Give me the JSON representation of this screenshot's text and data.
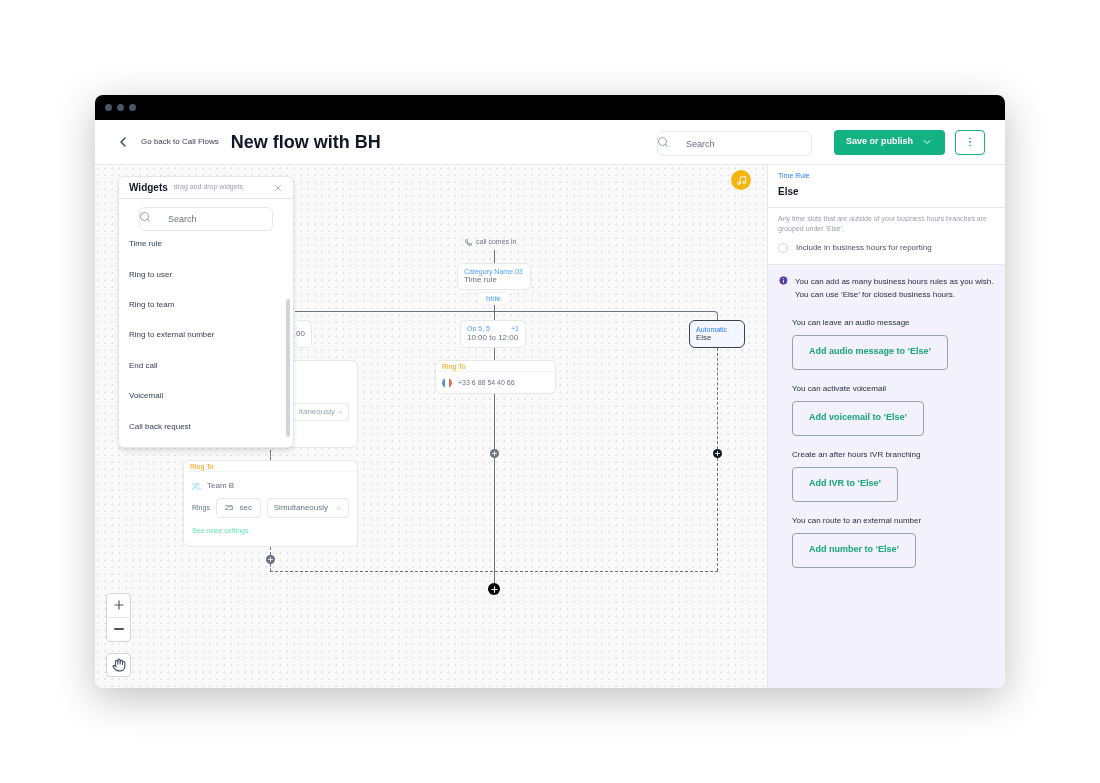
{
  "header": {
    "back_link": "Go back to Call Flows",
    "title": "New flow with BH",
    "search": {
      "placeholder": "Search"
    },
    "primary_button": "Save or publish"
  },
  "widgets_panel": {
    "title": "Widgets",
    "subtitle": "drag and drop widgets",
    "search": {
      "placeholder": "Search"
    },
    "items": [
      "Time rule",
      "Ring to user",
      "Ring to team",
      "Ring to external number",
      "End call",
      "Voicemail",
      "Call back request"
    ]
  },
  "flow": {
    "trigger": "call comes in",
    "rule_node": {
      "category": "Category Name 03",
      "title": "Time rule"
    },
    "toggle": "hide",
    "branch_nodes": [
      {
        "kind": "partial",
        "text": "00",
        "selected": false
      },
      {
        "kind": "slot",
        "label": "On 5, 5",
        "badge": "+1",
        "text": "10:00 to 12:00",
        "selected": false
      },
      {
        "kind": "automatic",
        "label": "Automatic",
        "text": "Else",
        "selected": true
      }
    ],
    "partial_card": {
      "dropdown": "ltaneously"
    },
    "ring_number": {
      "label": "Ring To",
      "number": "+33 6 88 54 40 66"
    },
    "ring_team": {
      "label": "Ring To",
      "team": "Team B",
      "rings_label": "Rings",
      "rings_value": "25",
      "unit": "sec",
      "mode": "Simultaneously",
      "link": "See more settings"
    }
  },
  "inspector": {
    "label": "Time Rule",
    "title": "Else",
    "description": "Any time slots that are outside of your business hours branches are grouped under ‘Else’.",
    "checkbox": {
      "label": "Include in business hours for reporting",
      "checked": false
    },
    "info": "You can add as many business hours rules as you wish. You can use ‘Else’ for closed business hours.",
    "actions": [
      {
        "caption": "You can leave an audio message",
        "button": "Add audio message to ‘Else’"
      },
      {
        "caption": "You can activate voicemail",
        "button": "Add voicemail to ‘Else’"
      },
      {
        "caption": "Create an after hours IVR branching",
        "button": "Add IVR to ‘Else’"
      },
      {
        "caption": "You can route to an external number",
        "button": "Add number to ‘Else’"
      }
    ]
  }
}
